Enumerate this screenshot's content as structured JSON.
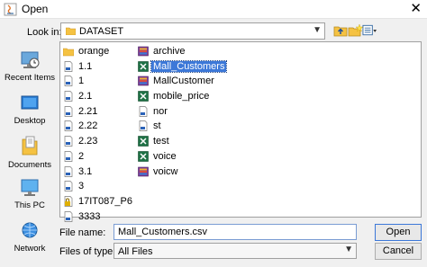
{
  "window": {
    "title": "Open"
  },
  "lookin": {
    "label": "Look in:",
    "value": "DATASET"
  },
  "toolbar": {
    "up": "up-folder-icon",
    "new_folder": "new-folder-icon",
    "view": "view-menu-icon"
  },
  "places": [
    {
      "label": "Recent Items",
      "icon": "recent-items-icon"
    },
    {
      "label": "Desktop",
      "icon": "desktop-icon"
    },
    {
      "label": "Documents",
      "icon": "documents-icon"
    },
    {
      "label": "This PC",
      "icon": "this-pc-icon"
    },
    {
      "label": "Network",
      "icon": "network-icon"
    }
  ],
  "files_col1": [
    {
      "name": "orange",
      "icon": "folder"
    },
    {
      "name": "1.1",
      "icon": "file"
    },
    {
      "name": "1",
      "icon": "file"
    },
    {
      "name": "2.1",
      "icon": "file"
    },
    {
      "name": "2.21",
      "icon": "file"
    },
    {
      "name": "2.22",
      "icon": "file"
    },
    {
      "name": "2.23",
      "icon": "file"
    },
    {
      "name": "2",
      "icon": "file"
    },
    {
      "name": "3.1",
      "icon": "file"
    },
    {
      "name": "3",
      "icon": "file"
    },
    {
      "name": "17IT087_P6",
      "icon": "locked"
    },
    {
      "name": "3333",
      "icon": "file"
    }
  ],
  "files_col2": [
    {
      "name": "archive",
      "icon": "archive"
    },
    {
      "name": "Mall_Customers",
      "icon": "excel",
      "selected": true
    },
    {
      "name": "MallCustomer",
      "icon": "archive"
    },
    {
      "name": "mobile_price",
      "icon": "excel"
    },
    {
      "name": "nor",
      "icon": "file"
    },
    {
      "name": "st",
      "icon": "file"
    },
    {
      "name": "test",
      "icon": "excel"
    },
    {
      "name": "voice",
      "icon": "excel"
    },
    {
      "name": "voicw",
      "icon": "archive"
    }
  ],
  "filename": {
    "label": "File name:",
    "value": "Mall_Customers.csv"
  },
  "filetype": {
    "label": "Files of type:",
    "value": "All Files"
  },
  "buttons": {
    "open": "Open",
    "cancel": "Cancel"
  },
  "colors": {
    "selection": "#3c78d8",
    "folder": "#f5c242",
    "excel": "#1e7145"
  }
}
